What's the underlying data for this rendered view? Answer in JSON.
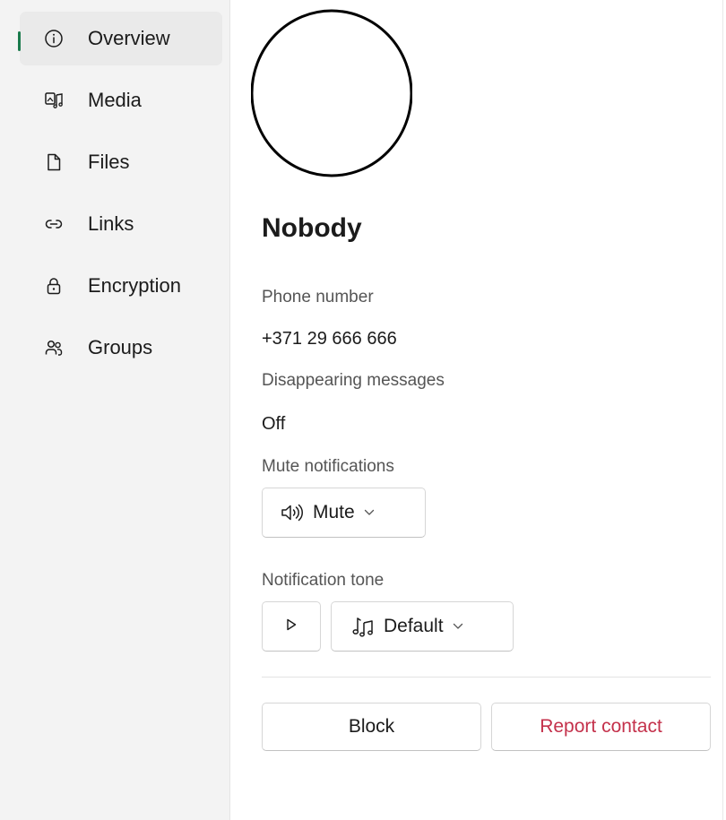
{
  "sidebar": {
    "items": [
      {
        "label": "Overview",
        "icon": "info-icon",
        "active": true
      },
      {
        "label": "Media",
        "icon": "media-icon",
        "active": false
      },
      {
        "label": "Files",
        "icon": "file-icon",
        "active": false
      },
      {
        "label": "Links",
        "icon": "link-icon",
        "active": false
      },
      {
        "label": "Encryption",
        "icon": "lock-icon",
        "active": false
      },
      {
        "label": "Groups",
        "icon": "people-icon",
        "active": false
      }
    ]
  },
  "contact": {
    "name": "Nobody",
    "phone_label": "Phone number",
    "phone_value": "+371 29 666 666",
    "disappearing_label": "Disappearing messages",
    "disappearing_value": "Off",
    "mute_label": "Mute notifications",
    "mute_button": "Mute",
    "tone_label": "Notification tone",
    "tone_button": "Default"
  },
  "actions": {
    "block": "Block",
    "report": "Report contact"
  },
  "colors": {
    "accent": "#1a7a4c",
    "danger": "#c4314b"
  }
}
